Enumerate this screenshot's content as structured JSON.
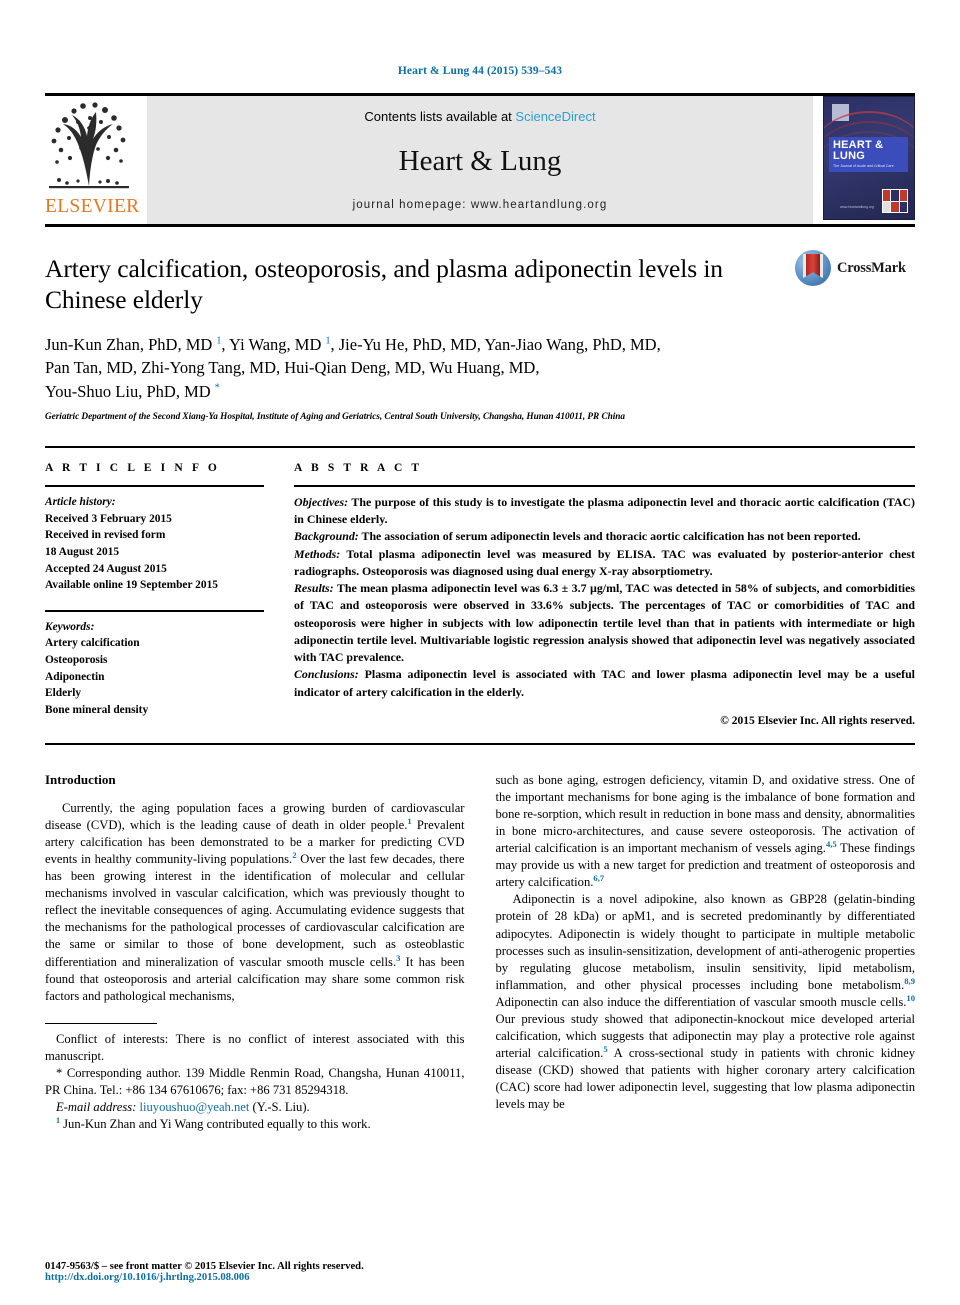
{
  "running_head": "Heart & Lung 44 (2015) 539–543",
  "masthead": {
    "publisher_wordmark": "ELSEVIER",
    "contents_prefix": "Contents lists available at ",
    "contents_link": "ScienceDirect",
    "journal_title": "Heart & Lung",
    "homepage_label": "journal homepage: www.heartandlung.org",
    "cover": {
      "title": "HEART & LUNG",
      "subtitle": "The Journal of Acute and Critical Care",
      "url": "www.heartandlung.org"
    }
  },
  "article": {
    "title": "Artery calcification, osteoporosis, and plasma adiponectin levels in Chinese elderly",
    "crossmark_label": "CrossMark",
    "authors_lines": [
      "Jun-Kun Zhan, PhD, MD ¹, Yi Wang, MD ¹, Jie-Yu He, PhD, MD, Yan-Jiao Wang, PhD, MD,",
      "Pan Tan, MD, Zhi-Yong Tang, MD, Hui-Qian Deng, MD, Wu Huang, MD,",
      "You-Shuo Liu, PhD, MD *"
    ],
    "affiliation": "Geriatric Department of the Second Xiang-Ya Hospital, Institute of Aging and Geriatrics, Central South University, Changsha, Hunan 410011, PR China"
  },
  "article_info": {
    "heading": "A R T I C L E  I N F O",
    "history_label": "Article history:",
    "history": [
      "Received 3 February 2015",
      "Received in revised form",
      "18 August 2015",
      "Accepted 24 August 2015",
      "Available online 19 September 2015"
    ],
    "keywords_label": "Keywords:",
    "keywords": [
      "Artery calcification",
      "Osteoporosis",
      "Adiponectin",
      "Elderly",
      "Bone mineral density"
    ]
  },
  "abstract": {
    "heading": "A B S T R A C T",
    "sections": [
      {
        "label": "Objectives:",
        "text": " The purpose of this study is to investigate the plasma adiponectin level and thoracic aortic calcification (TAC) in Chinese elderly."
      },
      {
        "label": "Background:",
        "text": " The association of serum adiponectin levels and thoracic aortic calcification has not been reported."
      },
      {
        "label": "Methods:",
        "text": " Total plasma adiponectin level was measured by ELISA. TAC was evaluated by posterior-anterior chest radiographs. Osteoporosis was diagnosed using dual energy X-ray absorptiometry."
      },
      {
        "label": "Results:",
        "text": " The mean plasma adiponectin level was 6.3 ± 3.7 µg/ml, TAC was detected in 58% of subjects, and comorbidities of TAC and osteoporosis were observed in 33.6% subjects. The percentages of TAC or comorbidities of TAC and osteoporosis were higher in subjects with low adiponectin tertile level than that in patients with intermediate or high adiponectin tertile level. Multivariable logistic regression analysis showed that adiponectin level was negatively associated with TAC prevalence."
      },
      {
        "label": "Conclusions:",
        "text": " Plasma adiponectin level is associated with TAC and lower plasma adiponectin level may be a useful indicator of artery calcification in the elderly."
      }
    ],
    "copyright": "© 2015 Elsevier Inc. All rights reserved."
  },
  "body": {
    "intro_heading": "Introduction",
    "left_paragraph_1": "Currently, the aging population faces a growing burden of cardiovascular disease (CVD), which is the leading cause of death in older people.",
    "left_ref_1": "1",
    "left_paragraph_1b": " Prevalent artery calcification has been demonstrated to be a marker for predicting CVD events in healthy community-living populations.",
    "left_ref_2": "2",
    "left_paragraph_1c": " Over the last few decades, there has been growing interest in the identification of molecular and cellular mechanisms involved in vascular calcification, which was previously thought to reflect the inevitable consequences of aging. Accumulating evidence suggests that the mechanisms for the pathological processes of cardiovascular calcification are the same or similar to those of bone development, such as osteoblastic differentiation and mineralization of vascular smooth muscle cells.",
    "left_ref_3": "3",
    "left_paragraph_1d": " It has been found that osteoporosis and arterial calcification may share some common risk factors and pathological mechanisms,",
    "right_paragraph_1a": "such as bone aging, estrogen deficiency, vitamin D, and oxidative stress. One of the important mechanisms for bone aging is the imbalance of bone formation and bone re-sorption, which result in reduction in bone mass and density, abnormalities in bone micro-architectures, and cause severe osteoporosis. The activation of arterial calcification is an important mechanism of vessels aging.",
    "right_ref_1": "4,5",
    "right_paragraph_1b": " These findings may provide us with a new target for prediction and treatment of osteoporosis and artery calcification.",
    "right_ref_2": "6,7",
    "right_paragraph_2a": "Adiponectin is a novel adipokine, also known as GBP28 (gelatin-binding protein of 28 kDa) or apM1, and is secreted predominantly by differentiated adipocytes. Adiponectin is widely thought to participate in multiple metabolic processes such as insulin-sensitization, development of anti-atherogenic properties by regulating glucose metabolism, insulin sensitivity, lipid metabolism, inflammation, and other physical processes including bone metabolism.",
    "right_ref_3": "8,9",
    "right_paragraph_2b": " Adiponectin can also induce the differentiation of vascular smooth muscle cells.",
    "right_ref_4": "10",
    "right_paragraph_2c": " Our previous study showed that adiponectin-knockout mice developed arterial calcification, which suggests that adiponectin may play a protective role against arterial calcification.",
    "right_ref_5": "5",
    "right_paragraph_2d": " A cross-sectional study in patients with chronic kidney disease (CKD) showed that patients with higher coronary artery calcification (CAC) score had lower adiponectin level, suggesting that low plasma adiponectin levels may be"
  },
  "footnotes": {
    "conflict": "Conflict of interests: There is no conflict of interest associated with this manuscript.",
    "corresponding_marker": "*",
    "corresponding": " Corresponding author. 139 Middle Renmin Road, Changsha, Hunan 410011, PR China. Tel.: +86 134 67610676; fax: +86 731 85294318.",
    "email_label": "E-mail address:",
    "email": "liuyoushuo@yeah.net",
    "email_suffix": " (Y.-S. Liu).",
    "equal_marker": "1",
    "equal_contribution": " Jun-Kun Zhan and Yi Wang contributed equally to this work."
  },
  "page_footer": {
    "issn_line": "0147-9563/$ – see front matter © 2015 Elsevier Inc. All rights reserved.",
    "doi": "http://dx.doi.org/10.1016/j.hrtlng.2015.08.006"
  },
  "colors": {
    "link_blue": "#0b6fa4",
    "sciencedirect_blue": "#2a9fd6",
    "elsevier_orange": "#E87722"
  }
}
